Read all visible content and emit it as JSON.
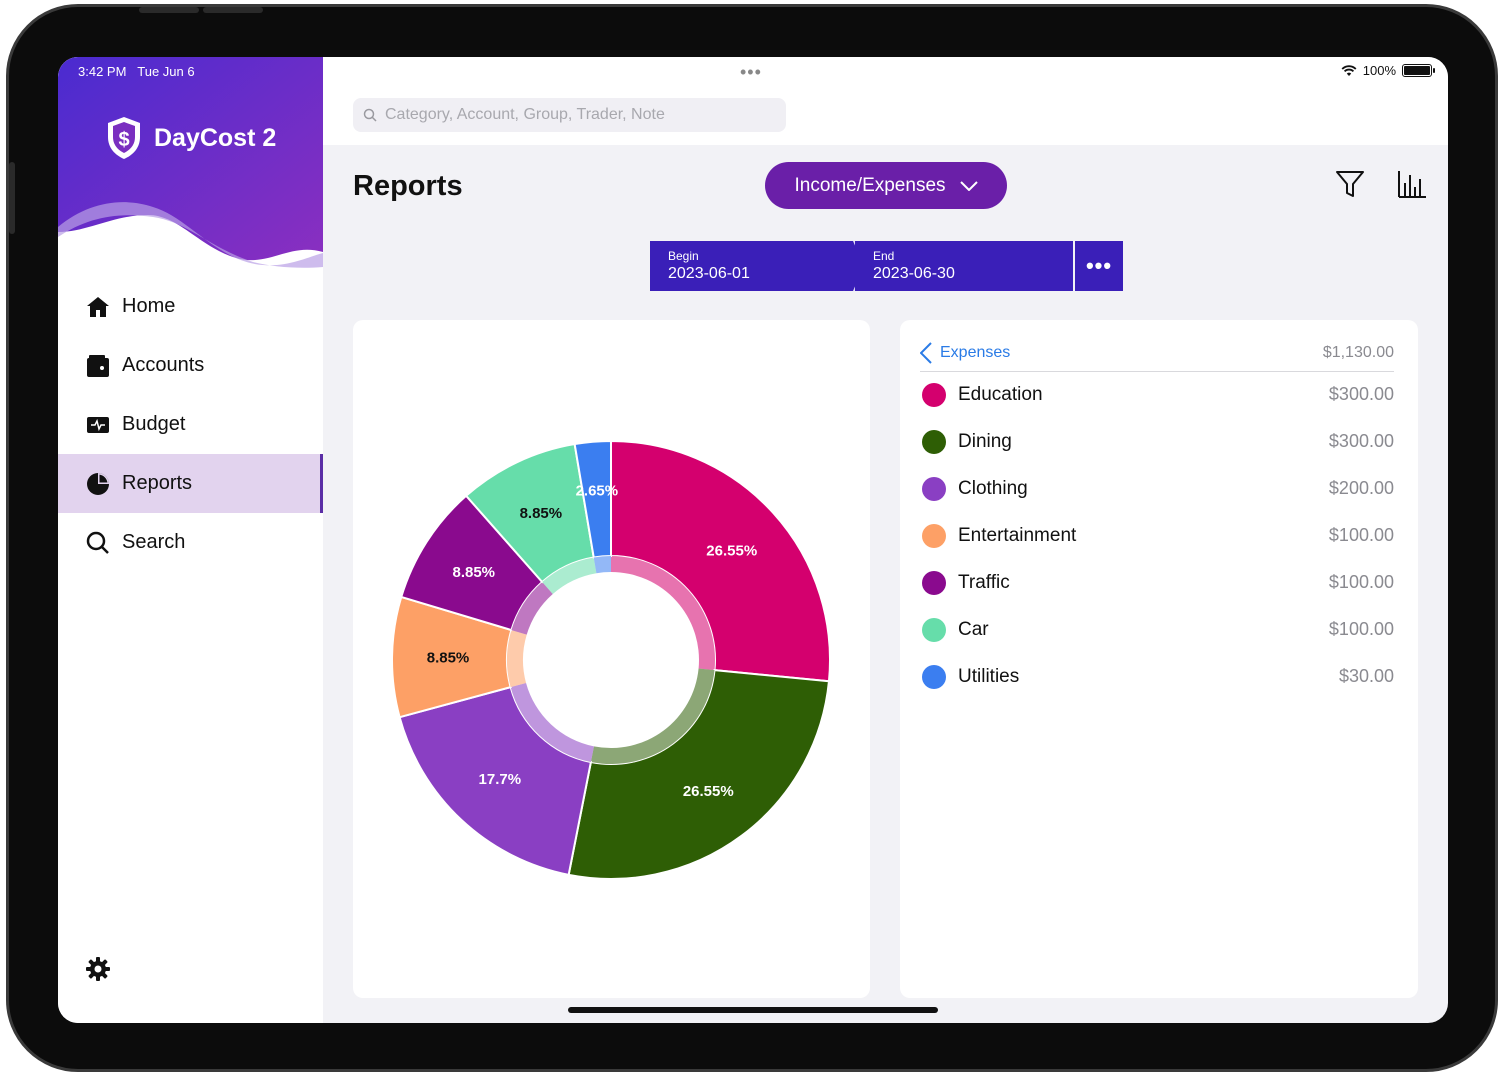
{
  "status": {
    "time": "3:42 PM",
    "date": "Tue Jun 6",
    "battery": "100%"
  },
  "app": {
    "name": "DayCost 2"
  },
  "sidebar": {
    "items": [
      {
        "label": "Home",
        "icon": "home-icon",
        "active": false
      },
      {
        "label": "Accounts",
        "icon": "wallet-icon",
        "active": false
      },
      {
        "label": "Budget",
        "icon": "budget-icon",
        "active": false
      },
      {
        "label": "Reports",
        "icon": "pie-chart-icon",
        "active": true
      },
      {
        "label": "Search",
        "icon": "search-icon",
        "active": false
      }
    ]
  },
  "search": {
    "placeholder": "Category, Account, Group, Trader, Note"
  },
  "main": {
    "title": "Reports",
    "report_type": "Income/Expenses",
    "range": {
      "begin_label": "Begin",
      "begin_value": "2023-06-01",
      "end_label": "End",
      "end_value": "2023-06-30"
    }
  },
  "list": {
    "back_label": "Expenses",
    "total": "$1,130.00",
    "items": [
      {
        "name": "Education",
        "amount": "$300.00",
        "color": "#d4006e"
      },
      {
        "name": "Dining",
        "amount": "$300.00",
        "color": "#2e5e05"
      },
      {
        "name": "Clothing",
        "amount": "$200.00",
        "color": "#8a3fc3"
      },
      {
        "name": "Entertainment",
        "amount": "$100.00",
        "color": "#fda066"
      },
      {
        "name": "Traffic",
        "amount": "$100.00",
        "color": "#8a0a8e"
      },
      {
        "name": "Car",
        "amount": "$100.00",
        "color": "#66ddaa"
      },
      {
        "name": "Utilities",
        "amount": "$30.00",
        "color": "#3b7ef0"
      }
    ]
  },
  "chart_data": {
    "type": "pie",
    "categories": [
      "Education",
      "Dining",
      "Clothing",
      "Entertainment",
      "Traffic",
      "Car",
      "Utilities"
    ],
    "values": [
      300,
      300,
      200,
      100,
      100,
      100,
      30
    ],
    "labels": [
      "26.55%",
      "26.55%",
      "17.7%",
      "8.85%",
      "8.85%",
      "8.85%",
      "2.65%"
    ],
    "colors": [
      "#d4006e",
      "#2e5e05",
      "#8a3fc3",
      "#fda066",
      "#8a0a8e",
      "#66ddaa",
      "#3b7ef0"
    ],
    "label_colors": [
      "#ffffff",
      "#ffffff",
      "#ffffff",
      "#111111",
      "#ffffff",
      "#111111",
      "#ffffff"
    ],
    "donut": true
  }
}
